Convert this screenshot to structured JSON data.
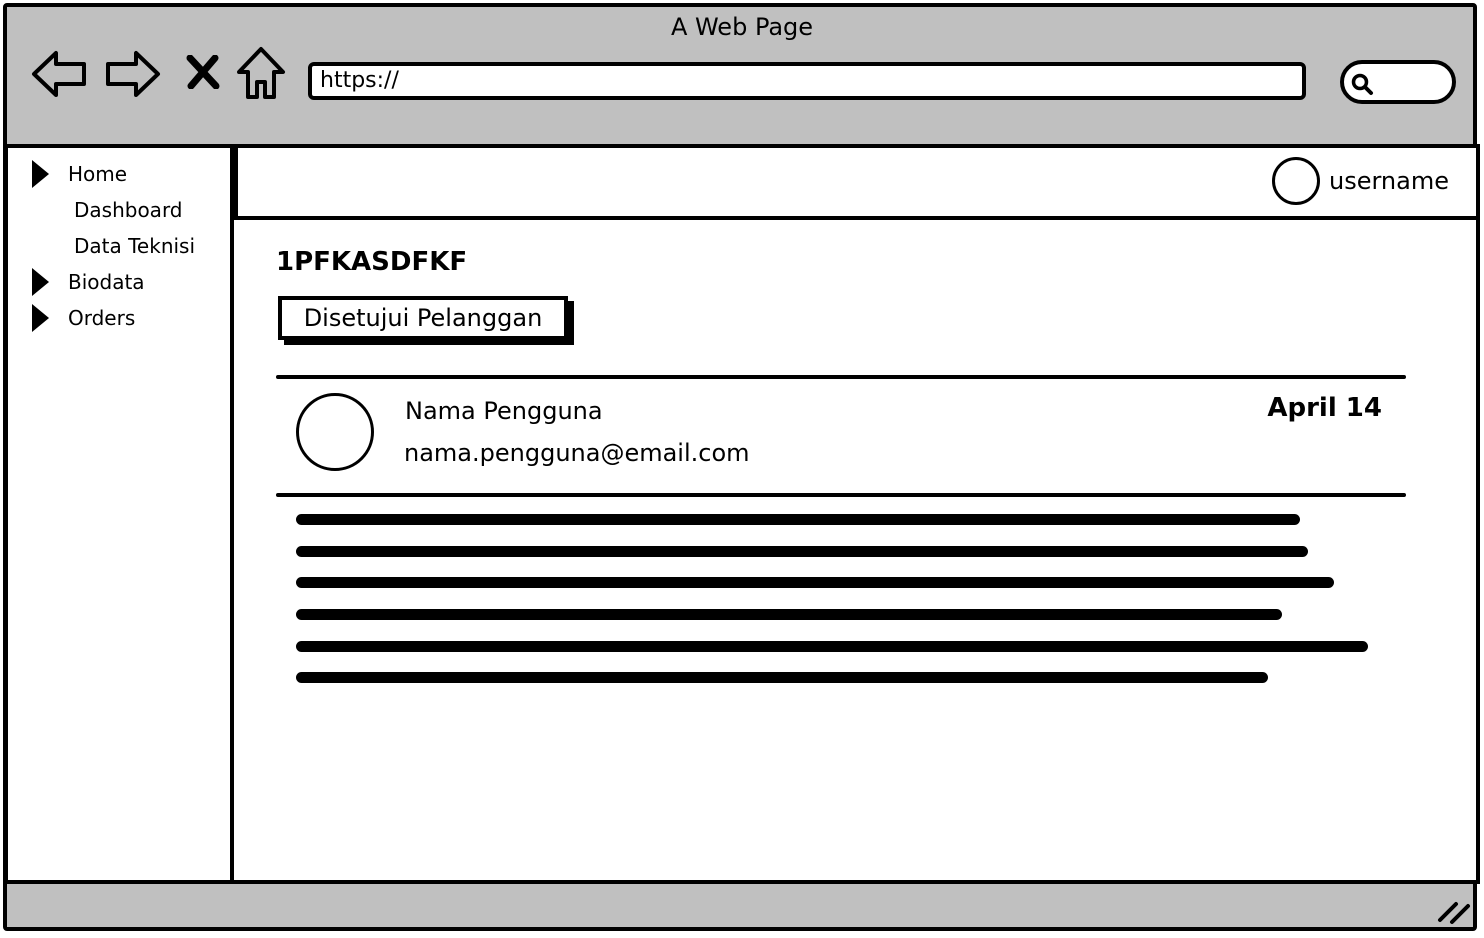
{
  "window": {
    "title": "A Web Page"
  },
  "toolbar": {
    "back_icon": "back-arrow-icon",
    "forward_icon": "forward-arrow-icon",
    "stop_icon": "close-icon",
    "home_icon": "home-icon",
    "url": "https://",
    "search_icon": "search-icon"
  },
  "sidebar": {
    "items": [
      {
        "label": "Home",
        "expandable": true
      },
      {
        "label": "Dashboard",
        "expandable": false
      },
      {
        "label": "Data Teknisi",
        "expandable": false
      },
      {
        "label": "Biodata",
        "expandable": true
      },
      {
        "label": "Orders",
        "expandable": true
      }
    ]
  },
  "header": {
    "username": "username"
  },
  "order": {
    "id": "1PFKASDFKF",
    "status_label": "Disetujui Pelanggan",
    "user": {
      "name": "Nama Pengguna",
      "email": "nama.pengguna@email.com"
    },
    "date": "April 14"
  },
  "colors": {
    "chrome": "#c0c0c0",
    "ink": "#000000",
    "surface": "#ffffff"
  }
}
